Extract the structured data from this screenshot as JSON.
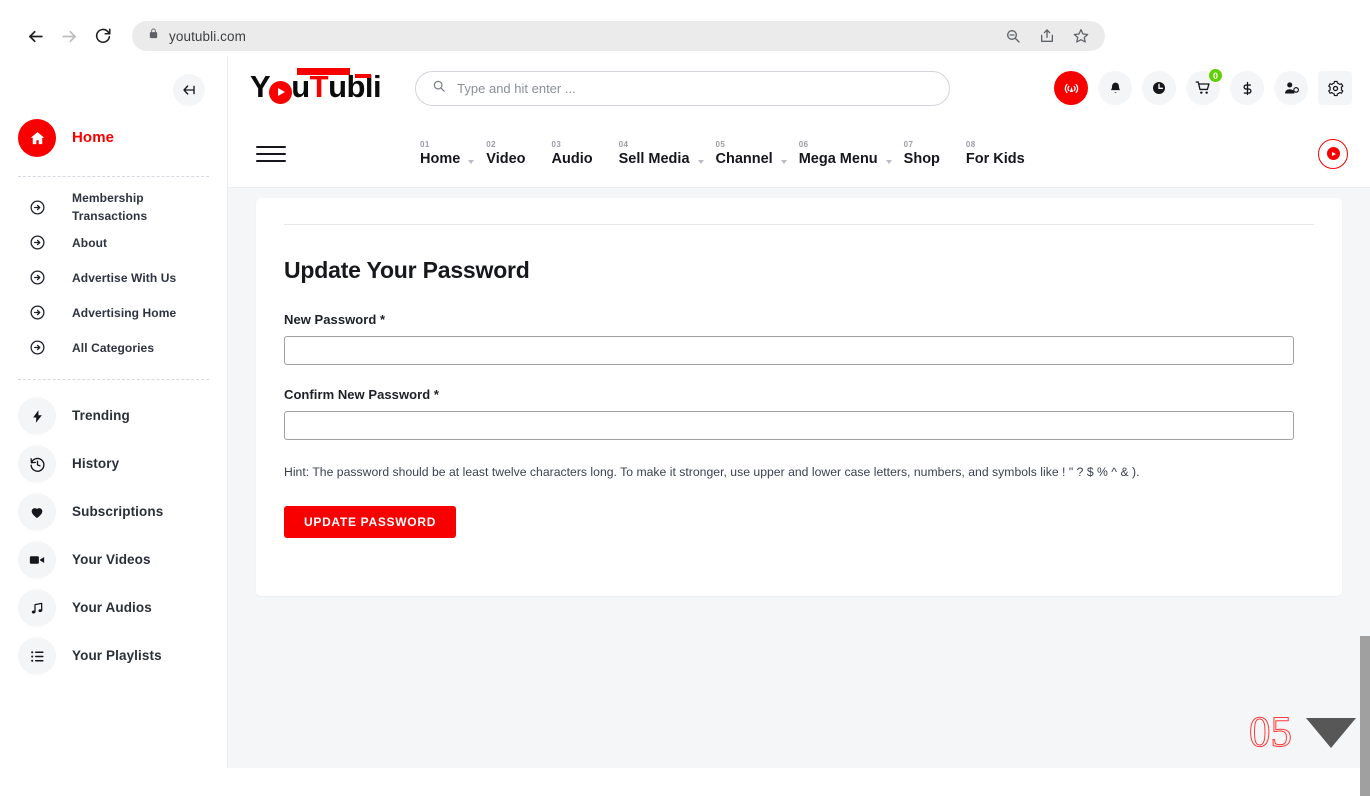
{
  "browser": {
    "url": "youtubli.com",
    "back_label": "Back",
    "forward_label": "Forward",
    "reload_label": "Reload",
    "zoom_out_label": "Zoom out",
    "share_label": "Share",
    "bookmark_label": "Bookmark this tab"
  },
  "colors": {
    "brand_red": "#f80000",
    "badge_green": "#5fd000",
    "page_bg": "#f5f6f8",
    "text_dark": "#17181d"
  },
  "sidebar": {
    "collapse_label": "Collapse",
    "primary": {
      "label": "Home",
      "icon": "home-icon"
    },
    "links": [
      {
        "label": "Membership Transactions",
        "icon": "arrow-circle-right-icon"
      },
      {
        "label": "About",
        "icon": "arrow-circle-right-icon"
      },
      {
        "label": "Advertise With Us",
        "icon": "arrow-circle-right-icon"
      },
      {
        "label": "Advertising Home",
        "icon": "arrow-circle-right-icon"
      },
      {
        "label": "All Categories",
        "icon": "arrow-circle-right-icon"
      }
    ],
    "items": [
      {
        "label": "Trending",
        "icon": "bolt-icon"
      },
      {
        "label": "History",
        "icon": "clock-rewind-icon"
      },
      {
        "label": "Subscriptions",
        "icon": "heart-icon"
      },
      {
        "label": "Your Videos",
        "icon": "video-camera-icon"
      },
      {
        "label": "Your Audios",
        "icon": "music-note-icon"
      },
      {
        "label": "Your Playlists",
        "icon": "list-icon"
      }
    ]
  },
  "header": {
    "logo": {
      "part1": "Y",
      "part2": "u",
      "part3": "T",
      "part4": "ubli",
      "alt": "YouTubli"
    },
    "search": {
      "placeholder": "Type and hit enter ...",
      "value": ""
    },
    "icons": [
      {
        "name": "live-broadcast-icon",
        "title": "Go Live"
      },
      {
        "name": "bell-icon",
        "title": "Notifications"
      },
      {
        "name": "clock-icon",
        "title": "Watch Later"
      },
      {
        "name": "cart-icon",
        "title": "Cart",
        "badge": "0"
      },
      {
        "name": "dollar-icon",
        "title": "Earnings"
      },
      {
        "name": "user-icon",
        "title": "Account"
      },
      {
        "name": "gear-icon",
        "title": "Settings"
      }
    ]
  },
  "mainnav": {
    "menu_label": "Menu",
    "record_label": "Record",
    "items": [
      {
        "num": "01",
        "label": "Home",
        "has_caret": true
      },
      {
        "num": "02",
        "label": "Video",
        "has_caret": false
      },
      {
        "num": "03",
        "label": "Audio",
        "has_caret": false
      },
      {
        "num": "04",
        "label": "Sell Media",
        "has_caret": true
      },
      {
        "num": "05",
        "label": "Channel",
        "has_caret": true
      },
      {
        "num": "06",
        "label": "Mega Menu",
        "has_caret": true
      },
      {
        "num": "07",
        "label": "Shop",
        "has_caret": false
      },
      {
        "num": "08",
        "label": "For Kids",
        "has_caret": false
      }
    ]
  },
  "main": {
    "title": "Update Your Password",
    "fields": [
      {
        "label": "New Password *",
        "value": "",
        "placeholder": ""
      },
      {
        "label": "Confirm New Password *",
        "value": "",
        "placeholder": ""
      }
    ],
    "hint": "Hint: The password should be at least twelve characters long. To make it stronger, use upper and lower case letters, numbers, and symbols like ! \" ? $ % ^ & ).",
    "submit_label": "UPDATE PASSWORD"
  },
  "corner": {
    "number": "05",
    "scroll_label": "Scroll down"
  }
}
